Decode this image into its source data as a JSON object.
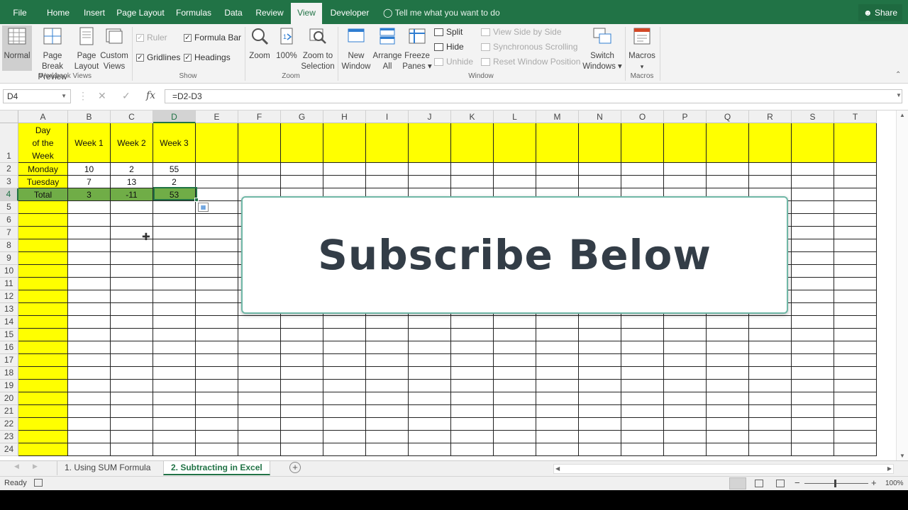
{
  "colors": {
    "brand": "#217346",
    "header_fill": "#ffff00",
    "total_fill": "#70ad47"
  },
  "tabs": [
    "File",
    "Home",
    "Insert",
    "Page Layout",
    "Formulas",
    "Data",
    "Review",
    "View",
    "Developer"
  ],
  "active_tab": "View",
  "tell_me": "Tell me what you want to do",
  "share": "Share",
  "ribbon": {
    "workbook_views": {
      "label": "Workbook Views",
      "buttons": [
        {
          "l1": "Normal",
          "l2": ""
        },
        {
          "l1": "Page Break",
          "l2": "Preview"
        },
        {
          "l1": "Page",
          "l2": "Layout"
        },
        {
          "l1": "Custom",
          "l2": "Views"
        }
      ]
    },
    "show": {
      "label": "Show",
      "ruler": "Ruler",
      "formula_bar": "Formula Bar",
      "gridlines": "Gridlines",
      "headings": "Headings"
    },
    "zoom": {
      "label": "Zoom",
      "buttons": [
        {
          "l1": "Zoom",
          "l2": ""
        },
        {
          "l1": "100%",
          "l2": ""
        },
        {
          "l1": "Zoom to",
          "l2": "Selection"
        }
      ]
    },
    "window": {
      "label": "Window",
      "new_window": {
        "l1": "New",
        "l2": "Window"
      },
      "arrange_all": {
        "l1": "Arrange",
        "l2": "All"
      },
      "freeze_panes": {
        "l1": "Freeze",
        "l2": "Panes ▾"
      },
      "split": "Split",
      "hide": "Hide",
      "unhide": "Unhide",
      "view_side": "View Side by Side",
      "sync_scroll": "Synchronous Scrolling",
      "reset_pos": "Reset Window Position",
      "switch": {
        "l1": "Switch",
        "l2": "Windows ▾"
      }
    },
    "macros": {
      "label": "Macros",
      "button": "Macros",
      "arrow": "▾"
    }
  },
  "formula_bar": {
    "name_box": "D4",
    "cancel": "✕",
    "enter": "✓",
    "fx": "fx",
    "formula": "=D2-D3"
  },
  "columns": [
    "A",
    "B",
    "C",
    "D",
    "E",
    "F",
    "G",
    "H",
    "I",
    "J",
    "K",
    "L",
    "M",
    "N",
    "O",
    "P",
    "Q",
    "R",
    "S",
    "T"
  ],
  "rows": [
    "1",
    "2",
    "3",
    "4",
    "5",
    "6",
    "7",
    "8",
    "9",
    "10",
    "11",
    "12",
    "13",
    "14",
    "15",
    "16",
    "17",
    "18",
    "19",
    "20",
    "21",
    "22",
    "23",
    "24"
  ],
  "table": {
    "header": [
      "Day of the Week",
      "Week 1",
      "Week 2",
      "Week 3"
    ],
    "header_lines": [
      "Day",
      "of the",
      "Week"
    ],
    "data": [
      [
        "Monday",
        "10",
        "2",
        "55"
      ],
      [
        "Tuesday",
        "7",
        "13",
        "2"
      ],
      [
        "Total",
        "3",
        "-11",
        "53"
      ]
    ]
  },
  "overlay_text": "Subscribe Below",
  "sheet_tabs": [
    "1. Using SUM Formula",
    "2. Subtracting in Excel"
  ],
  "active_sheet": "2. Subtracting in Excel",
  "add_sheet": "+",
  "status": {
    "ready": "Ready",
    "zoom": "100%",
    "minus": "−",
    "plus": "+"
  }
}
